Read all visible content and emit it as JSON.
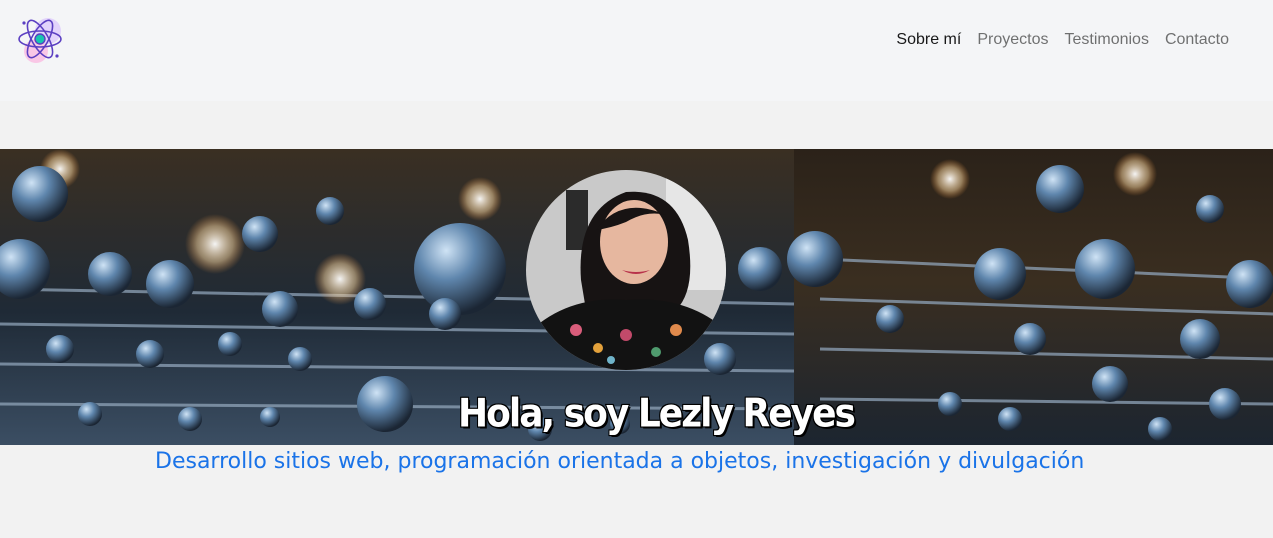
{
  "nav": {
    "items": [
      {
        "label": "Sobre mí",
        "active": true
      },
      {
        "label": "Proyectos",
        "active": false
      },
      {
        "label": "Testimonios",
        "active": false
      },
      {
        "label": "Contacto",
        "active": false
      }
    ]
  },
  "logo": {
    "icon": "atom-icon"
  },
  "hero": {
    "greeting": "Hola, soy Lezly Reyes",
    "tagline": "Desarrollo sitios web, programación orientada a objetos, investigación y divulgación c"
  },
  "colors": {
    "tagline": "#1a73e8",
    "nav_active": "#212529",
    "nav_inactive": "#6c757d",
    "navbar_bg": "#f4f5f7",
    "page_bg": "#f2f2f2"
  }
}
